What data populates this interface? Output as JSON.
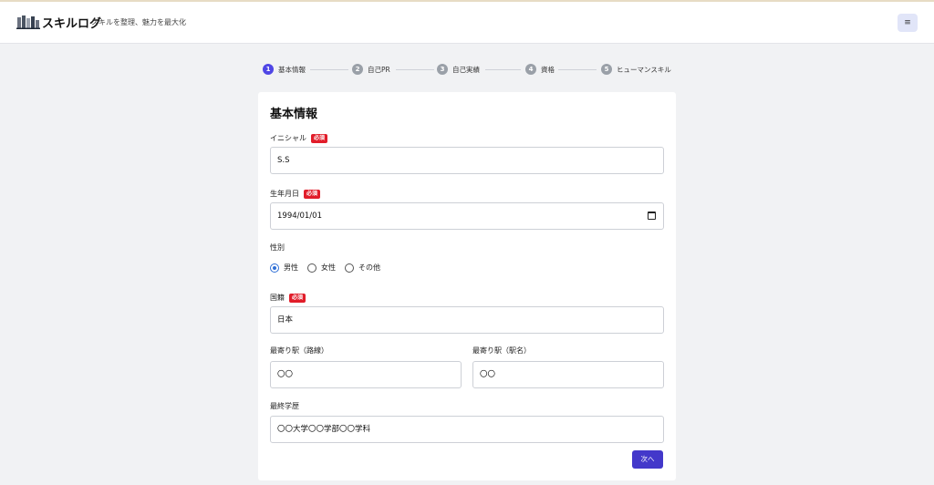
{
  "header": {
    "brand": "スキルログ",
    "tagline": "スキルを整理、魅力を最大化",
    "menu_icon": "≡"
  },
  "stepper": {
    "steps": [
      {
        "num": "1",
        "label": "基本情報",
        "active": true
      },
      {
        "num": "2",
        "label": "自己PR",
        "active": false
      },
      {
        "num": "3",
        "label": "自己実績",
        "active": false
      },
      {
        "num": "4",
        "label": "資格",
        "active": false
      },
      {
        "num": "5",
        "label": "ヒューマンスキル",
        "active": false
      }
    ]
  },
  "form": {
    "title": "基本情報",
    "required_badge": "必須",
    "initial": {
      "label": "イニシャル",
      "value": "S.S"
    },
    "birthdate": {
      "label": "生年月日",
      "value": "1994/01/01"
    },
    "gender": {
      "label": "性別",
      "options": [
        "男性",
        "女性",
        "その他"
      ],
      "selected": "男性"
    },
    "nationality": {
      "label": "国籍",
      "value": "日本"
    },
    "station_line": {
      "label": "最寄り駅（路線）",
      "value": "〇〇"
    },
    "station_name": {
      "label": "最寄り駅（駅名）",
      "value": "〇〇"
    },
    "education": {
      "label": "最終学歴",
      "value": "〇〇大学〇〇学部〇〇学科"
    },
    "next_label": "次へ"
  },
  "colors": {
    "accent": "#4f46e5",
    "required": "#e11d2a",
    "radio_selected": "#2f6fd6"
  }
}
